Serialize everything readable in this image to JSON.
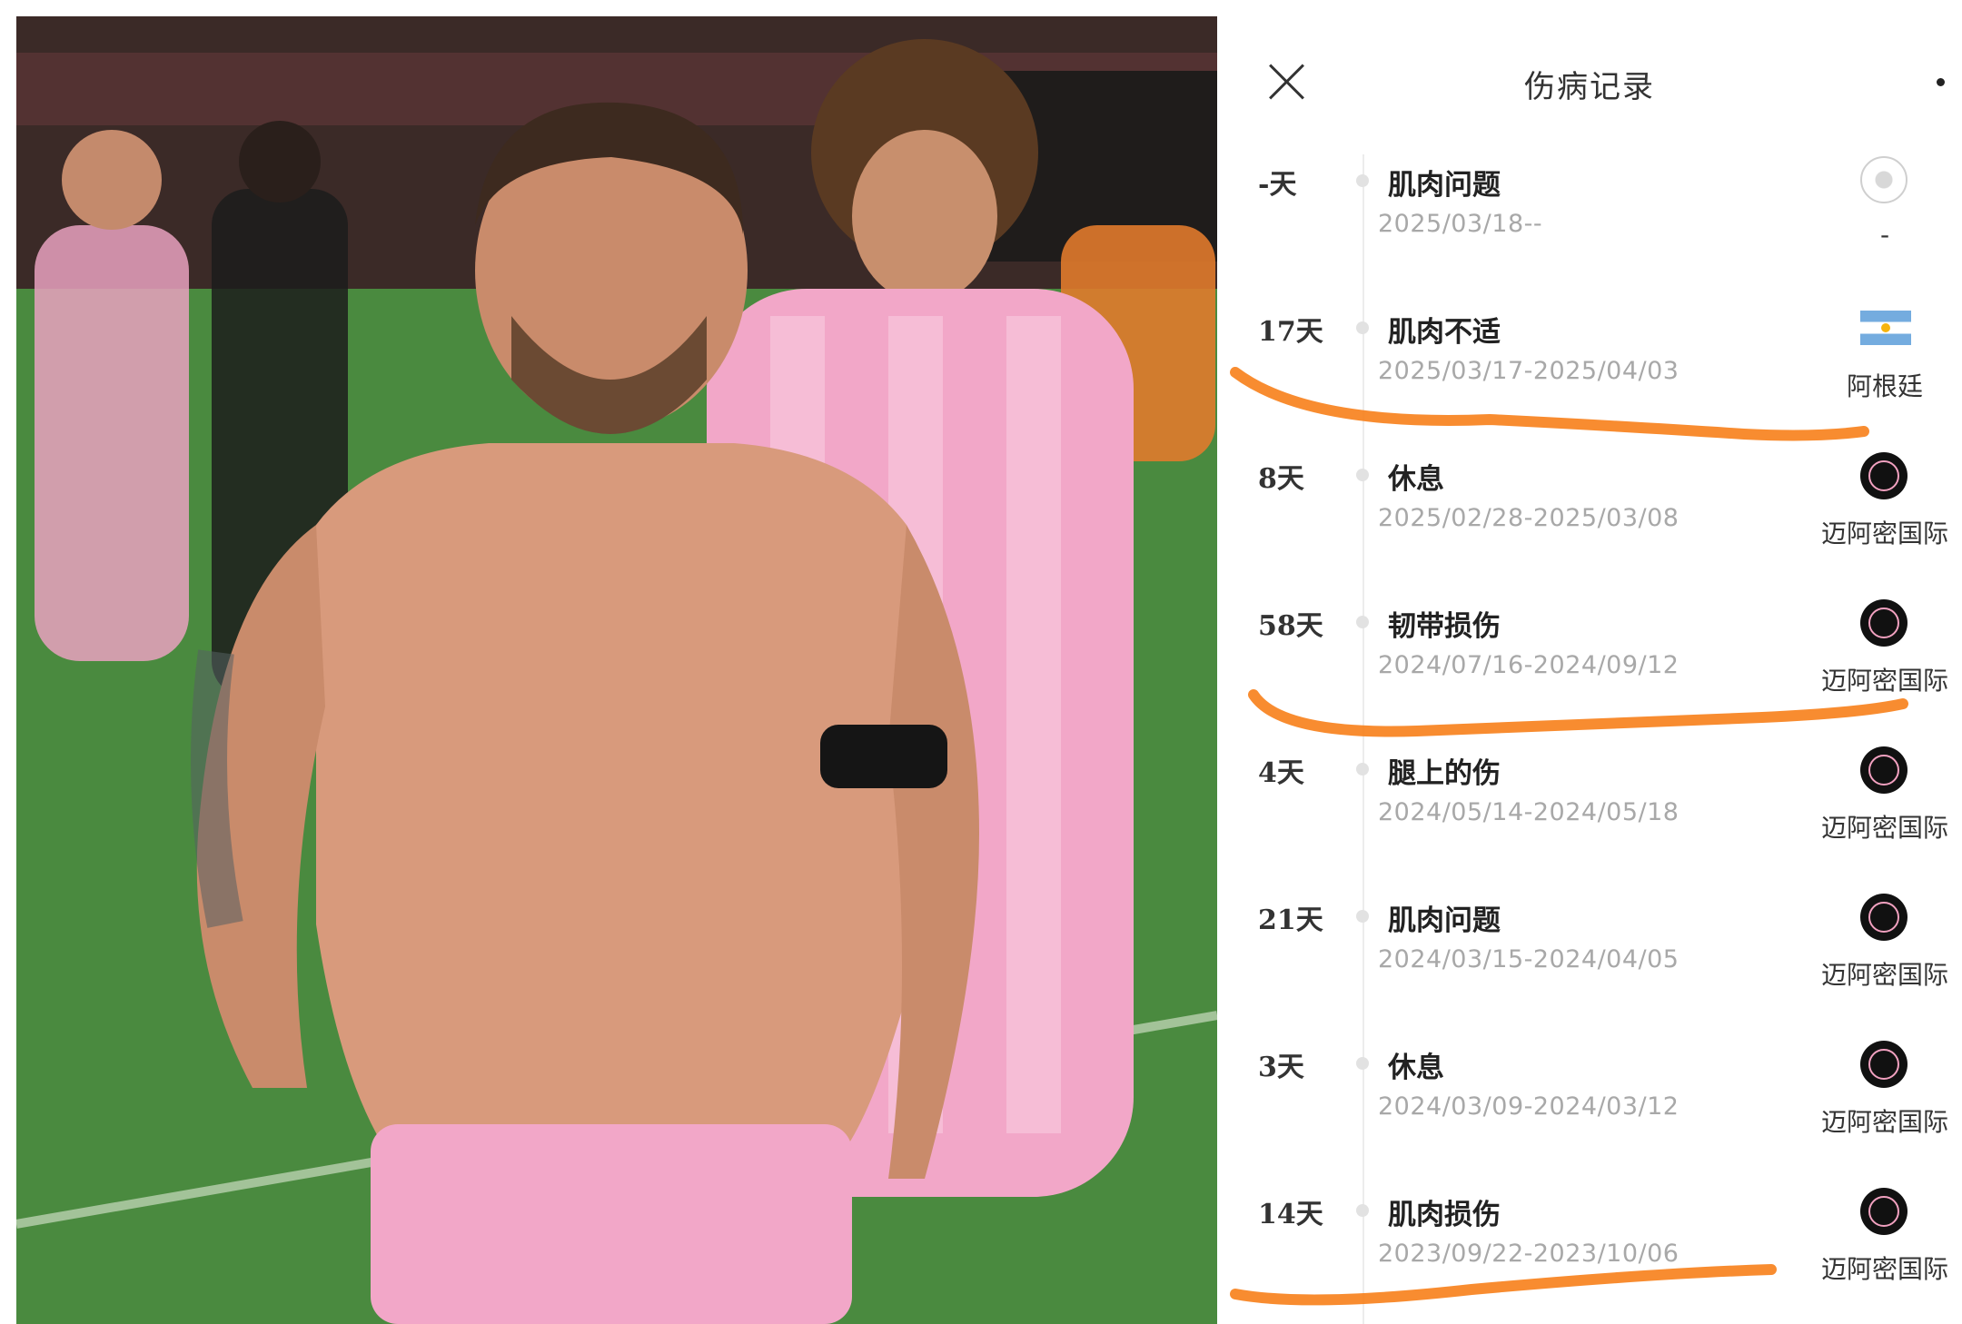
{
  "header": {
    "title": "伤病记录"
  },
  "colors": {
    "highlight": "#f77f1a",
    "club": "#111111",
    "muted": "#a8a8a8"
  },
  "records": [
    {
      "days": "-天",
      "type": "肌肉问题",
      "dates": "2025/03/18--",
      "team": "-",
      "icon": "football-icon"
    },
    {
      "days": "17天",
      "type": "肌肉不适",
      "dates": "2025/03/17-2025/04/03",
      "team": "阿根廷",
      "icon": "argentina-flag-icon"
    },
    {
      "days": "8天",
      "type": "休息",
      "dates": "2025/02/28-2025/03/08",
      "team": "迈阿密国际",
      "icon": "inter-miami-logo-icon"
    },
    {
      "days": "58天",
      "type": "韧带损伤",
      "dates": "2024/07/16-2024/09/12",
      "team": "迈阿密国际",
      "icon": "inter-miami-logo-icon"
    },
    {
      "days": "4天",
      "type": "腿上的伤",
      "dates": "2024/05/14-2024/05/18",
      "team": "迈阿密国际",
      "icon": "inter-miami-logo-icon"
    },
    {
      "days": "21天",
      "type": "肌肉问题",
      "dates": "2024/03/15-2024/04/05",
      "team": "迈阿密国际",
      "icon": "inter-miami-logo-icon"
    },
    {
      "days": "3天",
      "type": "休息",
      "dates": "2024/03/09-2024/03/12",
      "team": "迈阿密国际",
      "icon": "inter-miami-logo-icon"
    },
    {
      "days": "14天",
      "type": "肌肉损伤",
      "dates": "2023/09/22-2023/10/06",
      "team": "迈阿密国际",
      "icon": "inter-miami-logo-icon"
    }
  ]
}
